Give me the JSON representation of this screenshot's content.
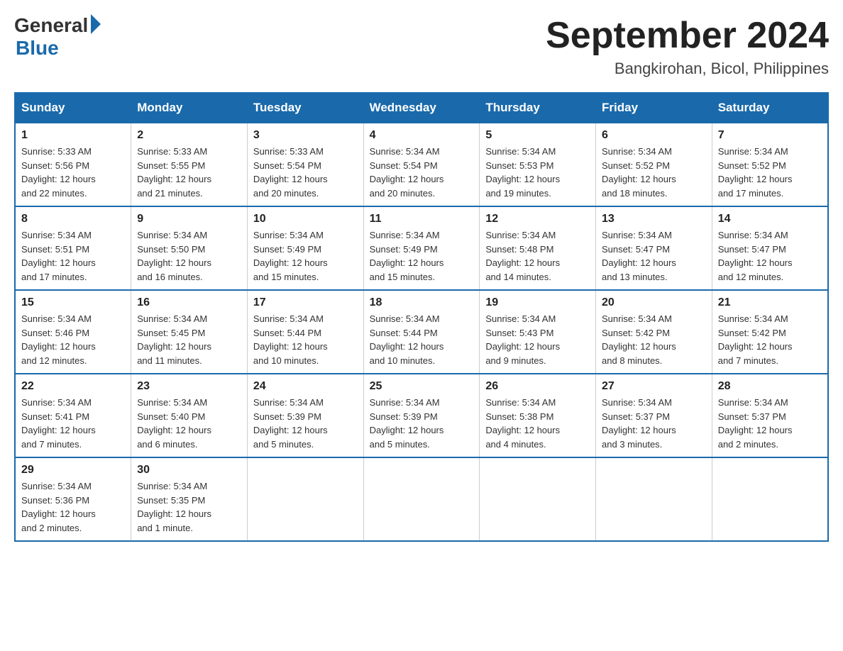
{
  "logo": {
    "general": "General",
    "blue": "Blue"
  },
  "title": "September 2024",
  "subtitle": "Bangkirohan, Bicol, Philippines",
  "days_header": [
    "Sunday",
    "Monday",
    "Tuesday",
    "Wednesday",
    "Thursday",
    "Friday",
    "Saturday"
  ],
  "weeks": [
    [
      {
        "day": "1",
        "info": "Sunrise: 5:33 AM\nSunset: 5:56 PM\nDaylight: 12 hours\nand 22 minutes."
      },
      {
        "day": "2",
        "info": "Sunrise: 5:33 AM\nSunset: 5:55 PM\nDaylight: 12 hours\nand 21 minutes."
      },
      {
        "day": "3",
        "info": "Sunrise: 5:33 AM\nSunset: 5:54 PM\nDaylight: 12 hours\nand 20 minutes."
      },
      {
        "day": "4",
        "info": "Sunrise: 5:34 AM\nSunset: 5:54 PM\nDaylight: 12 hours\nand 20 minutes."
      },
      {
        "day": "5",
        "info": "Sunrise: 5:34 AM\nSunset: 5:53 PM\nDaylight: 12 hours\nand 19 minutes."
      },
      {
        "day": "6",
        "info": "Sunrise: 5:34 AM\nSunset: 5:52 PM\nDaylight: 12 hours\nand 18 minutes."
      },
      {
        "day": "7",
        "info": "Sunrise: 5:34 AM\nSunset: 5:52 PM\nDaylight: 12 hours\nand 17 minutes."
      }
    ],
    [
      {
        "day": "8",
        "info": "Sunrise: 5:34 AM\nSunset: 5:51 PM\nDaylight: 12 hours\nand 17 minutes."
      },
      {
        "day": "9",
        "info": "Sunrise: 5:34 AM\nSunset: 5:50 PM\nDaylight: 12 hours\nand 16 minutes."
      },
      {
        "day": "10",
        "info": "Sunrise: 5:34 AM\nSunset: 5:49 PM\nDaylight: 12 hours\nand 15 minutes."
      },
      {
        "day": "11",
        "info": "Sunrise: 5:34 AM\nSunset: 5:49 PM\nDaylight: 12 hours\nand 15 minutes."
      },
      {
        "day": "12",
        "info": "Sunrise: 5:34 AM\nSunset: 5:48 PM\nDaylight: 12 hours\nand 14 minutes."
      },
      {
        "day": "13",
        "info": "Sunrise: 5:34 AM\nSunset: 5:47 PM\nDaylight: 12 hours\nand 13 minutes."
      },
      {
        "day": "14",
        "info": "Sunrise: 5:34 AM\nSunset: 5:47 PM\nDaylight: 12 hours\nand 12 minutes."
      }
    ],
    [
      {
        "day": "15",
        "info": "Sunrise: 5:34 AM\nSunset: 5:46 PM\nDaylight: 12 hours\nand 12 minutes."
      },
      {
        "day": "16",
        "info": "Sunrise: 5:34 AM\nSunset: 5:45 PM\nDaylight: 12 hours\nand 11 minutes."
      },
      {
        "day": "17",
        "info": "Sunrise: 5:34 AM\nSunset: 5:44 PM\nDaylight: 12 hours\nand 10 minutes."
      },
      {
        "day": "18",
        "info": "Sunrise: 5:34 AM\nSunset: 5:44 PM\nDaylight: 12 hours\nand 10 minutes."
      },
      {
        "day": "19",
        "info": "Sunrise: 5:34 AM\nSunset: 5:43 PM\nDaylight: 12 hours\nand 9 minutes."
      },
      {
        "day": "20",
        "info": "Sunrise: 5:34 AM\nSunset: 5:42 PM\nDaylight: 12 hours\nand 8 minutes."
      },
      {
        "day": "21",
        "info": "Sunrise: 5:34 AM\nSunset: 5:42 PM\nDaylight: 12 hours\nand 7 minutes."
      }
    ],
    [
      {
        "day": "22",
        "info": "Sunrise: 5:34 AM\nSunset: 5:41 PM\nDaylight: 12 hours\nand 7 minutes."
      },
      {
        "day": "23",
        "info": "Sunrise: 5:34 AM\nSunset: 5:40 PM\nDaylight: 12 hours\nand 6 minutes."
      },
      {
        "day": "24",
        "info": "Sunrise: 5:34 AM\nSunset: 5:39 PM\nDaylight: 12 hours\nand 5 minutes."
      },
      {
        "day": "25",
        "info": "Sunrise: 5:34 AM\nSunset: 5:39 PM\nDaylight: 12 hours\nand 5 minutes."
      },
      {
        "day": "26",
        "info": "Sunrise: 5:34 AM\nSunset: 5:38 PM\nDaylight: 12 hours\nand 4 minutes."
      },
      {
        "day": "27",
        "info": "Sunrise: 5:34 AM\nSunset: 5:37 PM\nDaylight: 12 hours\nand 3 minutes."
      },
      {
        "day": "28",
        "info": "Sunrise: 5:34 AM\nSunset: 5:37 PM\nDaylight: 12 hours\nand 2 minutes."
      }
    ],
    [
      {
        "day": "29",
        "info": "Sunrise: 5:34 AM\nSunset: 5:36 PM\nDaylight: 12 hours\nand 2 minutes."
      },
      {
        "day": "30",
        "info": "Sunrise: 5:34 AM\nSunset: 5:35 PM\nDaylight: 12 hours\nand 1 minute."
      },
      {
        "day": "",
        "info": ""
      },
      {
        "day": "",
        "info": ""
      },
      {
        "day": "",
        "info": ""
      },
      {
        "day": "",
        "info": ""
      },
      {
        "day": "",
        "info": ""
      }
    ]
  ]
}
